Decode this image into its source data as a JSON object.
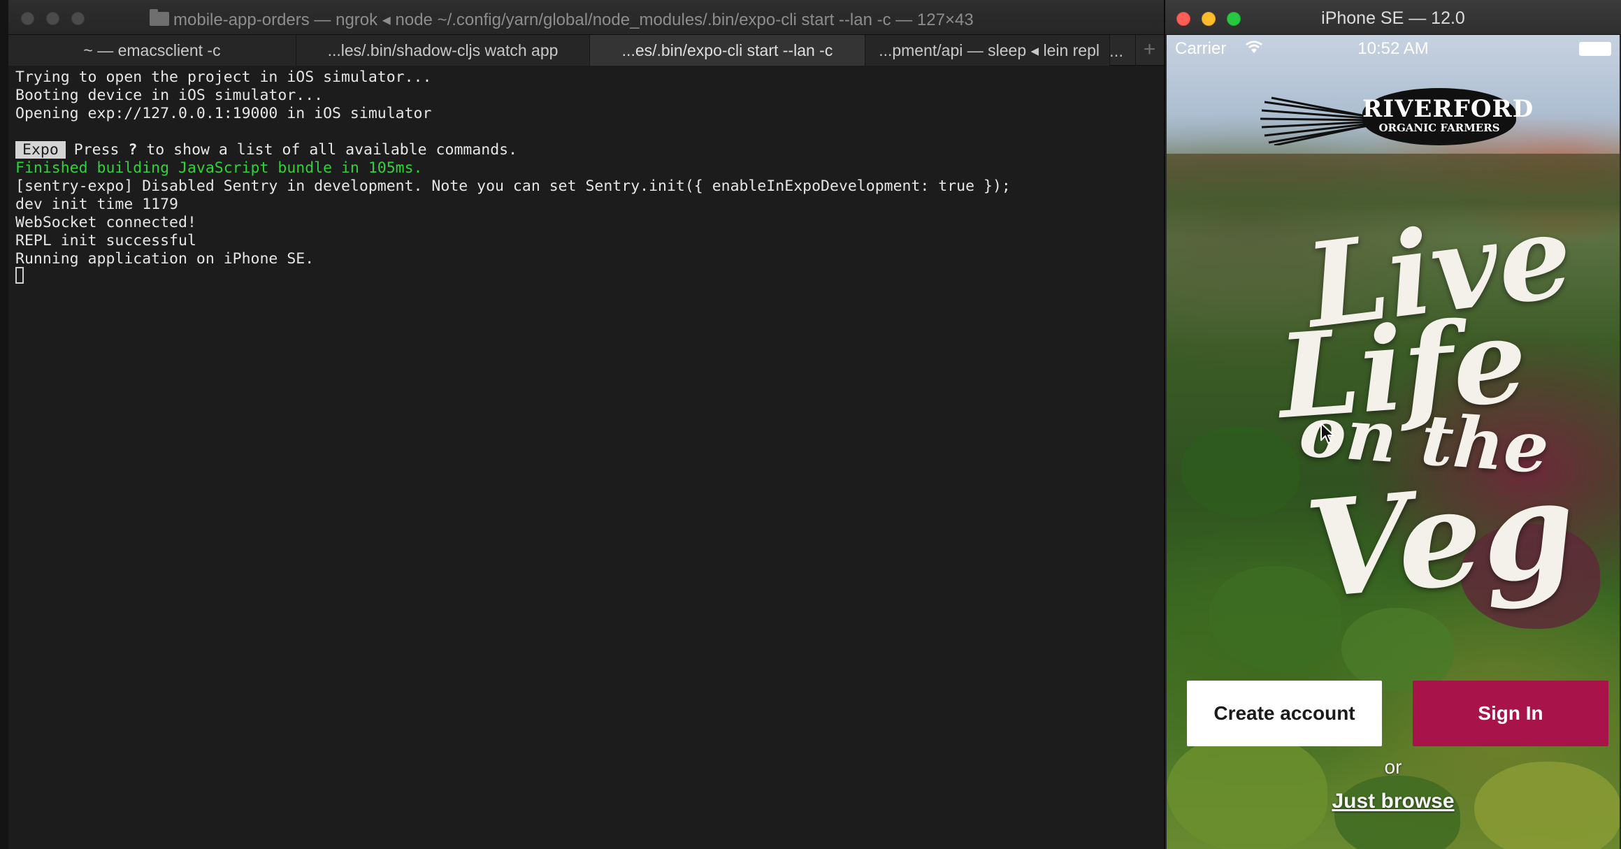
{
  "terminal": {
    "title": "mobile-app-orders — ngrok ◂ node ~/.config/yarn/global/node_modules/.bin/expo-cli start --lan -c — 127×43",
    "tabs": [
      {
        "label": "~ — emacsclient -c"
      },
      {
        "label": "...les/.bin/shadow-cljs watch app"
      },
      {
        "label": "...es/.bin/expo-cli start --lan -c"
      },
      {
        "label": "...pment/api — sleep ◂ lein repl"
      }
    ],
    "tab_more": "...",
    "tab_add": "+",
    "lines": {
      "l1": "Trying to open the project in iOS simulator...",
      "l2": "Booting device in iOS simulator...",
      "l3": "Opening exp://127.0.0.1:19000 in iOS simulator",
      "expo_badge": "Expo",
      "l4_a": "Press ",
      "l4_key": "?",
      "l4_b": " to show a list of all available commands.",
      "l5": "Finished building JavaScript bundle in 105ms.",
      "l6": "[sentry-expo] Disabled Sentry in development. Note you can set Sentry.init({ enableInExpoDevelopment: true });",
      "l7": "dev init time 1179",
      "l8": "WebSocket connected!",
      "l9": "REPL init successful",
      "l10": "Running application on iPhone SE."
    },
    "colors": {
      "success_text": "#2fd23a"
    }
  },
  "simulator": {
    "title": "iPhone SE — 12.0",
    "status": {
      "carrier": "Carrier",
      "time": "10:52 AM"
    },
    "logo": {
      "line1": "RIVERFORD",
      "line2": "ORGANIC FARMERS"
    },
    "hero": {
      "w1": "Live",
      "w2": "Life",
      "w3": "on the",
      "w4": "Veg"
    },
    "buttons": {
      "create_account": "Create account",
      "sign_in": "Sign In"
    },
    "or_text": "or",
    "just_browse": "Just browse",
    "colors": {
      "sign_in_bg": "#a81349",
      "create_bg": "#ffffff"
    },
    "icons": [
      "wifi-icon",
      "battery-icon",
      "close-icon",
      "minimize-icon",
      "zoom-icon"
    ]
  }
}
